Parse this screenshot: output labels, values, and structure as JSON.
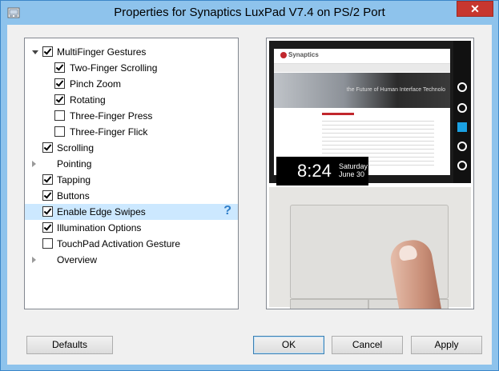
{
  "window": {
    "title": "Properties for Synaptics LuxPad V7.4 on PS/2 Port",
    "close_label": "✕"
  },
  "tree": {
    "items": [
      {
        "label": "MultiFinger Gestures",
        "checked": true,
        "expander": "open",
        "level": 0
      },
      {
        "label": "Two-Finger Scrolling",
        "checked": true,
        "level": 1
      },
      {
        "label": "Pinch Zoom",
        "checked": true,
        "level": 1
      },
      {
        "label": "Rotating",
        "checked": true,
        "level": 1
      },
      {
        "label": "Three-Finger Press",
        "checked": false,
        "level": 1
      },
      {
        "label": "Three-Finger Flick",
        "checked": false,
        "level": 1
      },
      {
        "label": "Scrolling",
        "checked": true,
        "level": 0
      },
      {
        "label": "Pointing",
        "expander": "closed",
        "level": 0
      },
      {
        "label": "Tapping",
        "checked": true,
        "level": 0
      },
      {
        "label": "Buttons",
        "checked": true,
        "level": 0
      },
      {
        "label": "Enable Edge Swipes",
        "checked": true,
        "level": 0,
        "selected": true,
        "help": "?"
      },
      {
        "label": "Illumination Options",
        "checked": true,
        "level": 0
      },
      {
        "label": "TouchPad Activation Gesture",
        "checked": false,
        "level": 0
      },
      {
        "label": "Overview",
        "expander": "closed",
        "level": 0
      }
    ]
  },
  "preview": {
    "logo": "Synaptics",
    "hero_text": "the Future of Human Interface Technolo",
    "clock_time": "8:24",
    "clock_day": "Saturday",
    "clock_date": "June 30"
  },
  "buttons": {
    "defaults": "Defaults",
    "ok": "OK",
    "cancel": "Cancel",
    "apply": "Apply"
  },
  "colors": {
    "selection": "#cce8ff",
    "title_bar": "#8ec3ec",
    "close": "#c7372f",
    "help": "#2f7ec9"
  }
}
